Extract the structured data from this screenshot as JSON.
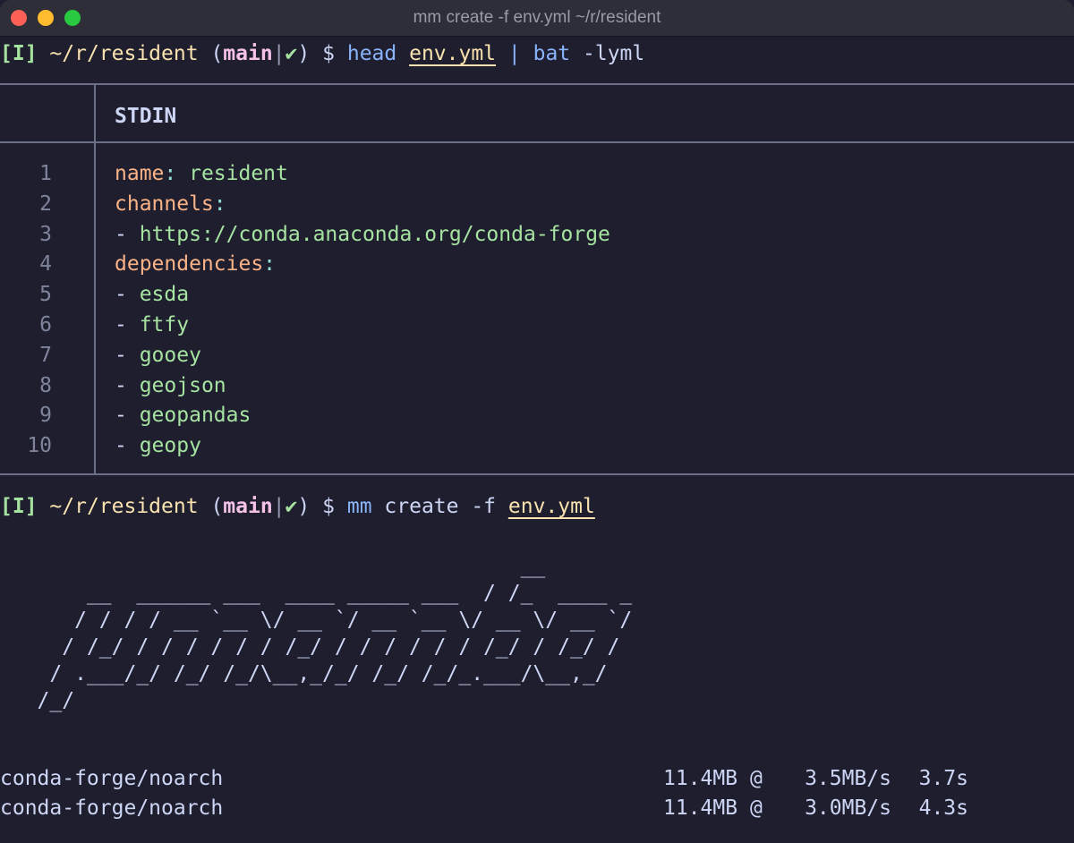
{
  "window": {
    "title": "mm create -f env.yml ~/r/resident"
  },
  "prompt1": {
    "mode": "[I]",
    "path": "~/r/resident",
    "open_paren": "(",
    "branch": "main",
    "sep": "|",
    "check": "✔",
    "close_paren": ")",
    "dollar": "$",
    "cmd": "head",
    "file": "env.yml",
    "pipe": "|",
    "pipecmd": "bat",
    "args": "-lyml"
  },
  "bat": {
    "header": "STDIN",
    "lines": [
      {
        "num": "1",
        "key": "name",
        "colon": ":",
        "value": " resident",
        "dash": ""
      },
      {
        "num": "2",
        "key": "channels",
        "colon": ":",
        "value": "",
        "dash": ""
      },
      {
        "num": "3",
        "key": "",
        "colon": "",
        "value": "https://conda.anaconda.org/conda-forge",
        "dash": "- "
      },
      {
        "num": "4",
        "key": "dependencies",
        "colon": ":",
        "value": "",
        "dash": ""
      },
      {
        "num": "5",
        "key": "",
        "colon": "",
        "value": "esda",
        "dash": "- "
      },
      {
        "num": "6",
        "key": "",
        "colon": "",
        "value": "ftfy",
        "dash": "- "
      },
      {
        "num": "7",
        "key": "",
        "colon": "",
        "value": "gooey",
        "dash": "- "
      },
      {
        "num": "8",
        "key": "",
        "colon": "",
        "value": "geojson",
        "dash": "- "
      },
      {
        "num": "9",
        "key": "",
        "colon": "",
        "value": "geopandas",
        "dash": "- "
      },
      {
        "num": "10",
        "key": "",
        "colon": "",
        "value": "geopy",
        "dash": "- "
      }
    ]
  },
  "prompt2": {
    "mode": "[I]",
    "path": "~/r/resident",
    "open_paren": "(",
    "branch": "main",
    "sep": "|",
    "check": "✔",
    "close_paren": ")",
    "dollar": "$",
    "cmd": "mm",
    "args": "create -f",
    "file": "env.yml"
  },
  "banner": {
    "ascii": "                                          __\n       __  ______ ___  ____ _____ ___  / /_  ____ _\n      / / / / __ `__ \\/ __ `/ __ `__ \\/ __ \\/ __ `/\n     / /_/ / / / / / / /_/ / / / / / / /_/ / /_/ /\n    / .___/_/ /_/ /_/\\__,_/_/ /_/ /_/_.___/\\__,_/\n   /_/"
  },
  "downloads": [
    {
      "name": "conda-forge/noarch",
      "size": "11.4MB",
      "at": "@",
      "speed": "3.5MB/s",
      "time": "3.7s"
    },
    {
      "name": "conda-forge/noarch",
      "size": "11.4MB",
      "at": "@",
      "speed": "3.0MB/s",
      "time": "4.3s"
    }
  ],
  "colors": {
    "background": "#1e1e2e",
    "mode_green": "#a6e3a1",
    "path_yellow": "#f9e2af",
    "branch_pink": "#f5c2e7",
    "command_blue": "#89b4fa",
    "yaml_key_orange": "#fab387",
    "yaml_value_green": "#a6e3a1"
  }
}
